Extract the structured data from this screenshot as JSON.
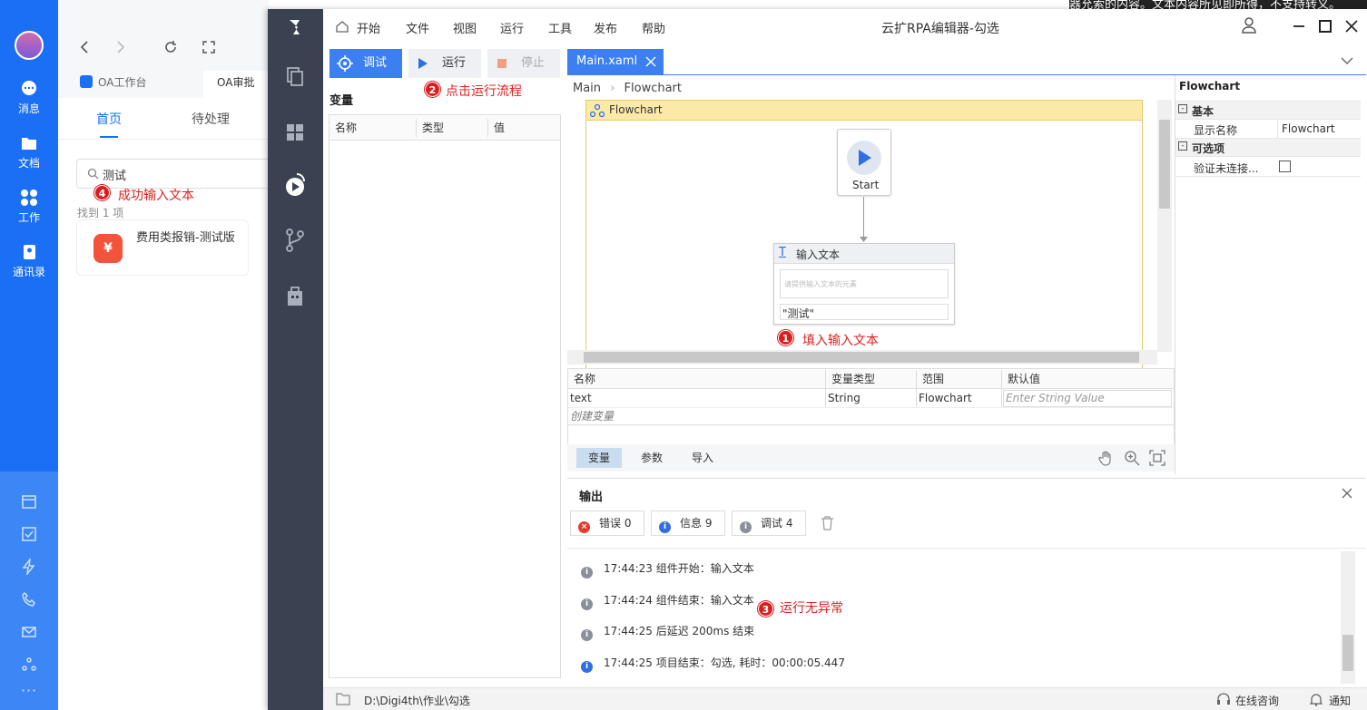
{
  "oa": {
    "sidebar": [
      {
        "label": "消息"
      },
      {
        "label": "文档"
      },
      {
        "label": "工作"
      },
      {
        "label": "通讯录"
      }
    ],
    "tabs": {
      "workbench": "OA工作台",
      "approval": "OA审批"
    },
    "subtabs": {
      "home": "首页",
      "pending": "待处理"
    },
    "search_value": "测试",
    "result_count": "找到 1 项",
    "result_item": "费用类报销-测试版",
    "result_icon_glyph": "¥"
  },
  "rpa": {
    "window_title": "云扩RPA编辑器-勾选",
    "menu": [
      "开始",
      "文件",
      "视图",
      "运行",
      "工具",
      "发布",
      "帮助"
    ],
    "toolbar": {
      "debug": "调试",
      "run": "运行",
      "stop": "停止"
    },
    "variables_panel": {
      "title": "变量",
      "headers": [
        "名称",
        "类型",
        "值"
      ]
    },
    "doc_tab": "Main.xaml",
    "breadcrumb": [
      "Main",
      "Flowchart"
    ],
    "flowchart": {
      "title": "Flowchart",
      "start_label": "Start",
      "activity_title": "输入文本",
      "activity_placeholder": "请提供输入文本的元素",
      "activity_value": "\"测试\""
    },
    "var_grid": {
      "headers": [
        "名称",
        "变量类型",
        "范围",
        "默认值"
      ],
      "rows": [
        {
          "name": "text",
          "type": "String",
          "scope": "Flowchart",
          "default": "Enter String Value"
        }
      ],
      "create": "创建变量"
    },
    "bottom_tabs": [
      "变量",
      "参数",
      "导入"
    ],
    "properties": {
      "title": "Flowchart",
      "group_basic": "基本",
      "display_name_label": "显示名称",
      "display_name_value": "Flowchart",
      "group_optional": "可选项",
      "validate_label": "验证未连接..."
    },
    "output": {
      "title": "输出",
      "error_label": "错误",
      "error_count": "0",
      "info_label": "信息",
      "info_count": "9",
      "debug_label": "调试",
      "debug_count": "4",
      "logs": [
        "17:44:23 组件开始：输入文本",
        "17:44:24 组件结束：输入文本",
        "17:44:25 后延迟 200ms 结束",
        "17:44:25 项目结束：勾选, 耗时：00:00:05.447"
      ]
    },
    "status": {
      "path": "D:\\Digi4th\\作业\\勾选",
      "consult": "在线咨询",
      "notify": "通知"
    }
  },
  "annotations": {
    "a1": {
      "num": "1",
      "text": "填入输入文本"
    },
    "a2": {
      "num": "2",
      "text": "点击运行流程"
    },
    "a3": {
      "num": "3",
      "text": "运行无异常"
    },
    "a4": {
      "num": "4",
      "text": "成功输入文本"
    }
  },
  "top_right_snippet": "器允索的内容。文本内容所见即所得，不支持转义。",
  "colors": {
    "oa_blue": "#1a6ff5",
    "rpa_side": "#3a4252",
    "toolbar_blue": "#3b7ff0",
    "annotation_red": "#e02020"
  }
}
